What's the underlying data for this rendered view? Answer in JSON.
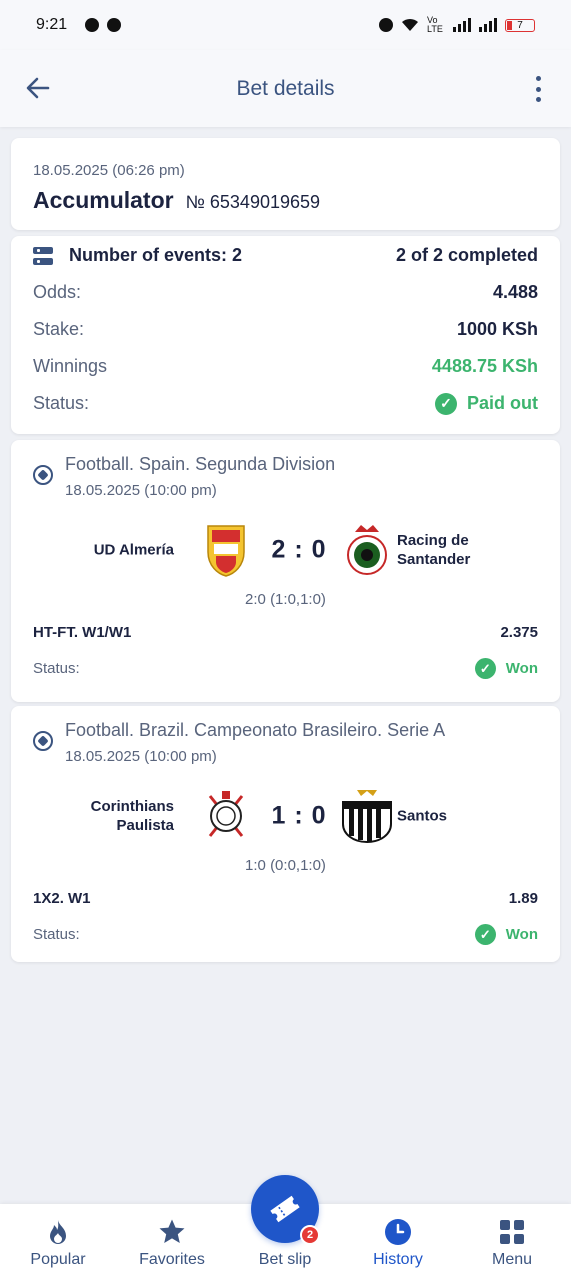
{
  "status_bar": {
    "time": "9:21",
    "battery": "7",
    "network": "Vo LTE"
  },
  "header": {
    "title": "Bet details"
  },
  "bet": {
    "date": "18.05.2025 (06:26 pm)",
    "type": "Accumulator",
    "number": "№ 65349019659"
  },
  "summary": {
    "events_label": "Number of events: 2",
    "completed": "2 of 2 completed",
    "odds_label": "Odds:",
    "odds_value": "4.488",
    "stake_label": "Stake:",
    "stake_value": "1000 KSh",
    "winnings_label": "Winnings",
    "winnings_value": "4488.75 KSh",
    "status_label": "Status:",
    "status_value": "Paid out"
  },
  "events": [
    {
      "league": "Football. Spain. Segunda Division",
      "date": "18.05.2025 (10:00 pm)",
      "home": "UD Almería",
      "away": "Racing de Santander",
      "score": "2 : 0",
      "detail_score": "2:0 (1:0,1:0)",
      "market": "HT-FT. W1/W1",
      "odds": "2.375",
      "status_label": "Status:",
      "status_value": "Won"
    },
    {
      "league": "Football. Brazil. Campeonato Brasileiro. Serie A",
      "date": "18.05.2025 (10:00 pm)",
      "home": "Corinthians Paulista",
      "away": "Santos",
      "score": "1 : 0",
      "detail_score": "1:0 (0:0,1:0)",
      "market": "1X2. W1",
      "odds": "1.89",
      "status_label": "Status:",
      "status_value": "Won"
    }
  ],
  "bottom_nav": {
    "popular": "Popular",
    "favorites": "Favorites",
    "bet_slip": "Bet slip",
    "bet_slip_badge": "2",
    "history": "History",
    "menu": "Menu",
    "active": "history"
  },
  "colors": {
    "accent": "#1f56c9",
    "win": "#3cb46e",
    "text": "#1c2340",
    "muted": "#59647c",
    "background": "#eef0f5"
  }
}
